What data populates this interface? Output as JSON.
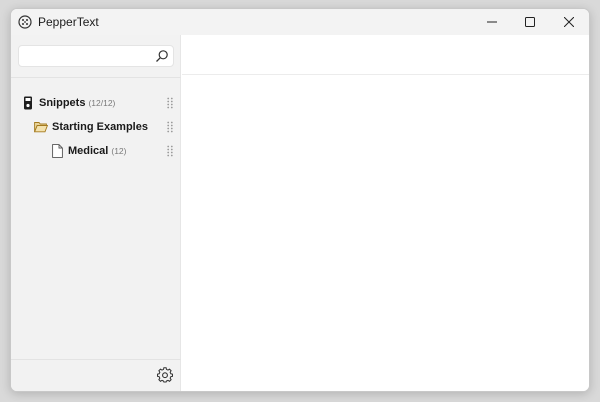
{
  "window": {
    "title": "PepperText",
    "controls": [
      "minimize",
      "maximize",
      "close"
    ]
  },
  "sidebar": {
    "search": {
      "value": "",
      "placeholder": ""
    },
    "tree": [
      {
        "label": "Snippets",
        "count": "(12/12)",
        "icon": "snippet-device-icon",
        "level": 0
      },
      {
        "label": "Starting Examples",
        "count": "",
        "icon": "folder-open-icon",
        "level": 1
      },
      {
        "label": "Medical",
        "count": "(12)",
        "icon": "document-icon",
        "level": 2
      }
    ],
    "footer": {
      "icon": "gear-icon"
    }
  },
  "colors": {
    "sidebar_bg": "#f2f2f2",
    "folder": "#c9a24a",
    "text": "#1a1a1a",
    "count": "#7a7a7a"
  }
}
